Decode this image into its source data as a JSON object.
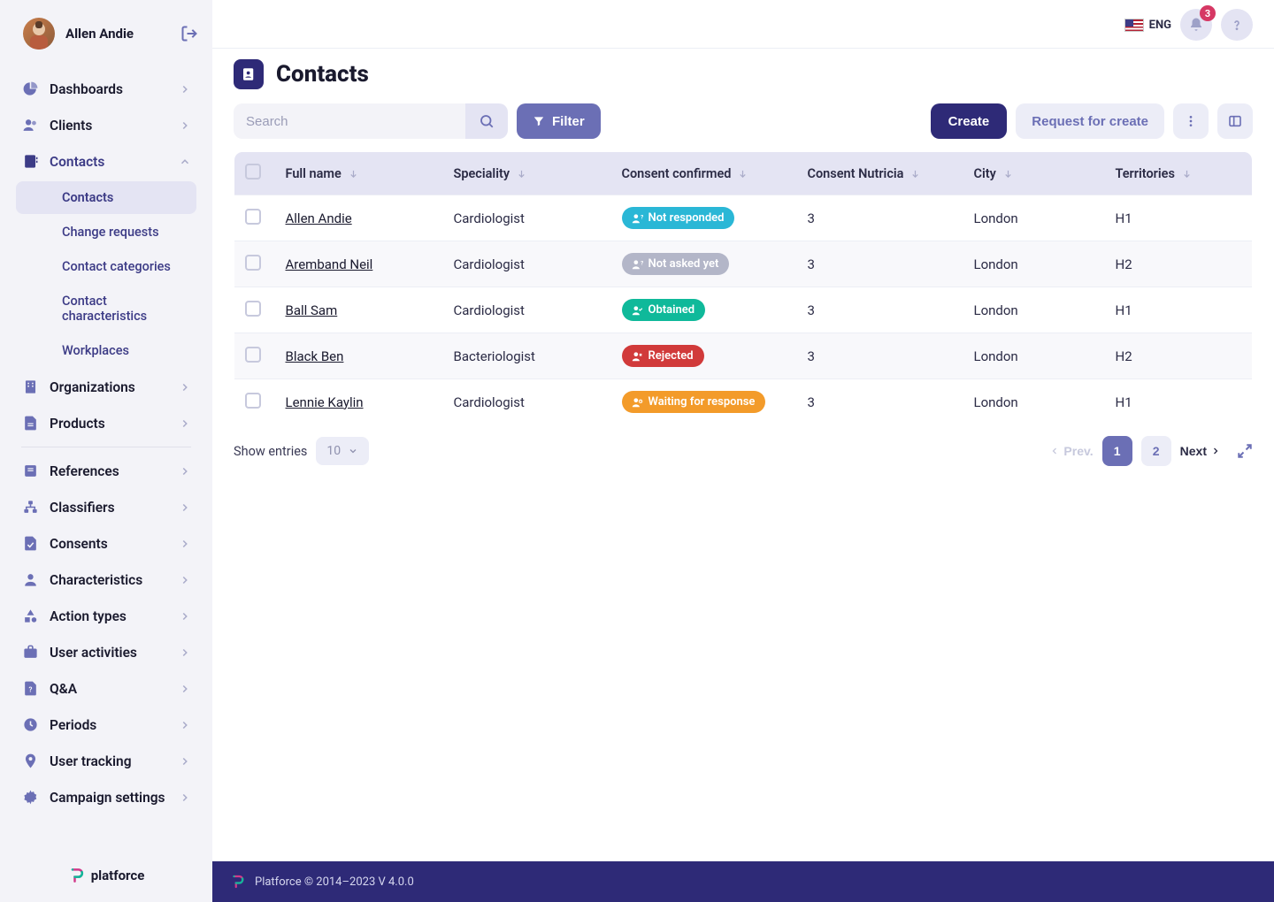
{
  "user": {
    "name": "Allen Andie"
  },
  "notification_count": "3",
  "language": {
    "label": "ENG"
  },
  "page": {
    "title": "Contacts"
  },
  "toolbar": {
    "search_placeholder": "Search",
    "filter_label": "Filter",
    "create_label": "Create",
    "request_label": "Request for create"
  },
  "nav": {
    "items": [
      {
        "label": "Dashboards",
        "icon": "pie"
      },
      {
        "label": "Clients",
        "icon": "users"
      },
      {
        "label": "Contacts",
        "icon": "contacts",
        "expanded": true,
        "sub": [
          {
            "label": "Contacts",
            "active": true
          },
          {
            "label": "Change requests"
          },
          {
            "label": "Contact categories"
          },
          {
            "label": "Contact characteristics"
          },
          {
            "label": "Workplaces"
          }
        ]
      },
      {
        "label": "Organizations",
        "icon": "building"
      },
      {
        "label": "Products",
        "icon": "file"
      },
      {
        "divider": true
      },
      {
        "label": "References",
        "icon": "book"
      },
      {
        "label": "Classifiers",
        "icon": "sitemap"
      },
      {
        "label": "Consents",
        "icon": "consent"
      },
      {
        "label": "Characteristics",
        "icon": "person"
      },
      {
        "label": "Action types",
        "icon": "shapes"
      },
      {
        "label": "User activities",
        "icon": "briefcase"
      },
      {
        "label": "Q&A",
        "icon": "qa"
      },
      {
        "label": "Periods",
        "icon": "clock"
      },
      {
        "label": "User tracking",
        "icon": "pin"
      },
      {
        "label": "Campaign settings",
        "icon": "gear"
      }
    ]
  },
  "brand": "platforce",
  "table": {
    "columns": [
      "Full name",
      "Speciality",
      "Consent confirmed",
      "Consent Nutricia",
      "City",
      "Territories"
    ],
    "rows": [
      {
        "name": "Allen Andie",
        "speciality": "Cardiologist",
        "consent": {
          "label": "Not responded",
          "class": "notresp"
        },
        "nutricia": "3",
        "city": "London",
        "territories": "H1"
      },
      {
        "name": "Aremband Neil",
        "speciality": "Cardiologist",
        "consent": {
          "label": "Not asked yet",
          "class": "notasked"
        },
        "nutricia": "3",
        "city": "London",
        "territories": "H2"
      },
      {
        "name": "Ball Sam",
        "speciality": "Cardiologist",
        "consent": {
          "label": "Obtained",
          "class": "obtained"
        },
        "nutricia": "3",
        "city": "London",
        "territories": "H1"
      },
      {
        "name": "Black Ben",
        "speciality": "Bacteriologist",
        "consent": {
          "label": "Rejected",
          "class": "rejected"
        },
        "nutricia": "3",
        "city": "London",
        "territories": "H2"
      },
      {
        "name": "Lennie Kaylin",
        "speciality": "Cardiologist",
        "consent": {
          "label": "Waiting for response",
          "class": "waiting"
        },
        "nutricia": "3",
        "city": "London",
        "territories": "H1"
      }
    ]
  },
  "pagination": {
    "show_entries_label": "Show entries",
    "page_size": "10",
    "prev": "Prev.",
    "next": "Next",
    "pages": [
      "1",
      "2"
    ],
    "active": "1"
  },
  "footer": {
    "text": "Platforce © 2014–2023 V 4.0.0"
  }
}
